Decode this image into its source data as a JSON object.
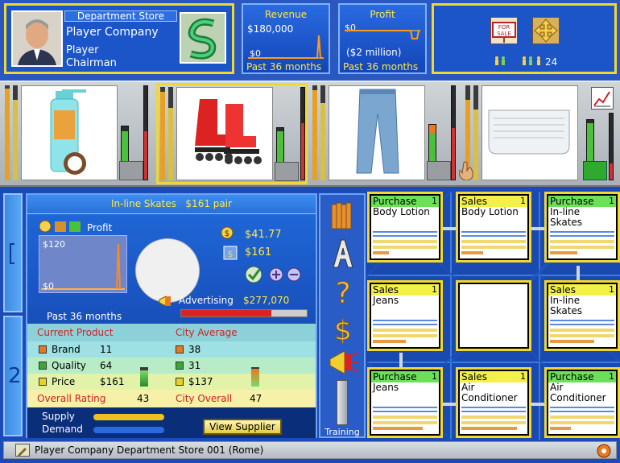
{
  "profile": {
    "label": "Department Store",
    "company": "Player Company",
    "player": "Player",
    "role": "Chairman"
  },
  "revenue": {
    "title": "Revenue",
    "top_value": "$180,000",
    "bottom_value": "$0",
    "period": "Past 36 months"
  },
  "profit_top": {
    "title": "Profit",
    "top_value": "$0",
    "value": "($2 million)",
    "period": "Past 36 months"
  },
  "traffic": {
    "count": "24"
  },
  "detail": {
    "product_title": "In-line Skates   $161 pair",
    "profit_label": "Profit",
    "chart_top": "$120",
    "chart_bottom": "$0",
    "chart_period": "Past 36 months",
    "cost": "$41.77",
    "price": "$161",
    "advertising_label": "Advertising",
    "advertising_value": "$277,070",
    "advertising_fraction": 0.72
  },
  "comparison": {
    "current_header": "Current Product",
    "city_header": "City Average",
    "rows": [
      {
        "label": "Brand",
        "current": "11",
        "city": "38",
        "color": "#e67a1a"
      },
      {
        "label": "Quality",
        "current": "64",
        "city": "31",
        "color": "#3fa53a"
      },
      {
        "label": "Price",
        "current": "$161",
        "city": "$137",
        "color": "#e8d22a"
      }
    ],
    "overall_label": "Overall Rating",
    "overall_value": "43",
    "city_overall_label": "City Overall",
    "city_overall_value": "47"
  },
  "supply": {
    "supply_label": "Supply",
    "demand_label": "Demand",
    "view_supplier_label": "View Supplier"
  },
  "side_tools": {
    "training_label": "Training"
  },
  "grid": {
    "cells": [
      {
        "type": "Purchase",
        "num": "1",
        "product": "Body Lotion",
        "header_color": "#6de05a"
      },
      {
        "type": "Sales",
        "num": "1",
        "product": "Body Lotion",
        "header_color": "#f3f04a"
      },
      {
        "type": "Purchase",
        "num": "1",
        "product": "In-line Skates",
        "header_color": "#6de05a"
      },
      {
        "type": "Sales",
        "num": "1",
        "product": "Jeans",
        "header_color": "#f3f04a"
      },
      {
        "type": "",
        "num": "",
        "product": "",
        "header_color": ""
      },
      {
        "type": "Sales",
        "num": "1",
        "product": "In-line Skates",
        "header_color": "#f3f04a"
      },
      {
        "type": "Purchase",
        "num": "1",
        "product": "Jeans",
        "header_color": "#6de05a"
      },
      {
        "type": "Sales",
        "num": "1",
        "product": "Air Conditioner",
        "header_color": "#f3f04a"
      },
      {
        "type": "Purchase",
        "num": "1",
        "product": "Air Conditioner",
        "header_color": "#6de05a"
      }
    ]
  },
  "status": {
    "text": "Player Company Department Store 001 (Rome)"
  }
}
